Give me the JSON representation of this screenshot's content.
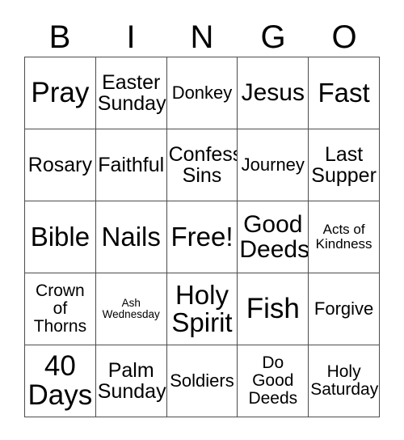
{
  "card": {
    "header_letters": [
      "B",
      "I",
      "N",
      "G",
      "O"
    ],
    "columns": 5,
    "rows": 5,
    "border_color": "#4d4d4d",
    "cell_background": "#ffffff",
    "text_color": "#000000",
    "cells": [
      {
        "text": "Pray",
        "row": 1,
        "column": "B",
        "size": "fs-xxl"
      },
      {
        "text": "Easter\nSunday",
        "row": 1,
        "column": "I",
        "size": "fs-m"
      },
      {
        "text": "Donkey",
        "row": 1,
        "column": "N",
        "size": "fs-sm"
      },
      {
        "text": "Jesus",
        "row": 1,
        "column": "G",
        "size": "fs-l"
      },
      {
        "text": "Fast",
        "row": 1,
        "column": "O",
        "size": "fs-xl"
      },
      {
        "text": "Rosary",
        "row": 2,
        "column": "B",
        "size": "fs-m"
      },
      {
        "text": "Faithful",
        "row": 2,
        "column": "I",
        "size": "fs-m"
      },
      {
        "text": "Confess\nSins",
        "row": 2,
        "column": "N",
        "size": "fs-m"
      },
      {
        "text": "Journey",
        "row": 2,
        "column": "G",
        "size": "fs-sm"
      },
      {
        "text": "Last\nSupper",
        "row": 2,
        "column": "O",
        "size": "fs-m"
      },
      {
        "text": "Bible",
        "row": 3,
        "column": "B",
        "size": "fs-xl"
      },
      {
        "text": "Nails",
        "row": 3,
        "column": "I",
        "size": "fs-xl"
      },
      {
        "text": "Free!",
        "row": 3,
        "column": "N",
        "size": "fs-xl"
      },
      {
        "text": "Good\nDeeds",
        "row": 3,
        "column": "G",
        "size": "fs-l"
      },
      {
        "text": "Acts of\nKindness",
        "row": 3,
        "column": "O",
        "size": "fs-xs"
      },
      {
        "text": "Crown\nof\nThorns",
        "row": 4,
        "column": "B",
        "size": "fs-s"
      },
      {
        "text": "Ash\nWednesday",
        "row": 4,
        "column": "I",
        "size": "fs-xxs"
      },
      {
        "text": "Holy\nSpirit",
        "row": 4,
        "column": "N",
        "size": "fs-xl"
      },
      {
        "text": "Fish",
        "row": 4,
        "column": "G",
        "size": "fs-xxl"
      },
      {
        "text": "Forgive",
        "row": 4,
        "column": "O",
        "size": "fs-sm"
      },
      {
        "text": "40\nDays",
        "row": 5,
        "column": "B",
        "size": "fs-xxl"
      },
      {
        "text": "Palm\nSunday",
        "row": 5,
        "column": "I",
        "size": "fs-m"
      },
      {
        "text": "Soldiers",
        "row": 5,
        "column": "N",
        "size": "fs-sm"
      },
      {
        "text": "Do\nGood\nDeeds",
        "row": 5,
        "column": "G",
        "size": "fs-s"
      },
      {
        "text": "Holy\nSaturday",
        "row": 5,
        "column": "O",
        "size": "fs-s"
      }
    ]
  }
}
